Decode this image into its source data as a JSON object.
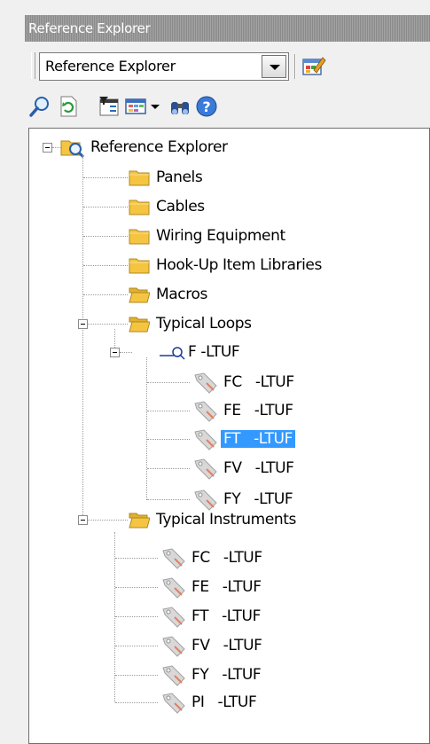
{
  "window": {
    "title": "Reference Explorer"
  },
  "toolbar": {
    "combo_value": "Reference Explorer",
    "icons": [
      "search-icon",
      "refresh-icon",
      "filter-icon",
      "grid-view-icon",
      "dropdown-arrow-icon",
      "find-icon",
      "help-icon",
      "edit-properties-icon"
    ]
  },
  "tree": {
    "root": "Reference Explorer",
    "folders": {
      "panels": "Panels",
      "cables": "Cables",
      "wiring": "Wiring Equipment",
      "hookup": "Hook-Up Item Libraries",
      "macros": "Macros",
      "typical_loops": "Typical Loops",
      "typical_instruments": "Typical Instruments"
    },
    "loop": {
      "name": "F -LTUF",
      "items": [
        "FC   -LTUF",
        "FE   -LTUF",
        "FT   -LTUF",
        "FV   -LTUF",
        "FY   -LTUF"
      ]
    },
    "instruments": [
      "FC   -LTUF",
      "FE   -LTUF",
      "FT   -LTUF",
      "FV   -LTUF",
      "FY   -LTUF",
      "PI   -LTUF"
    ],
    "selected": "FT   -LTUF"
  },
  "colors": {
    "selection": "#3399ff",
    "titlebar": "#999999",
    "folder": "#f5c542"
  }
}
